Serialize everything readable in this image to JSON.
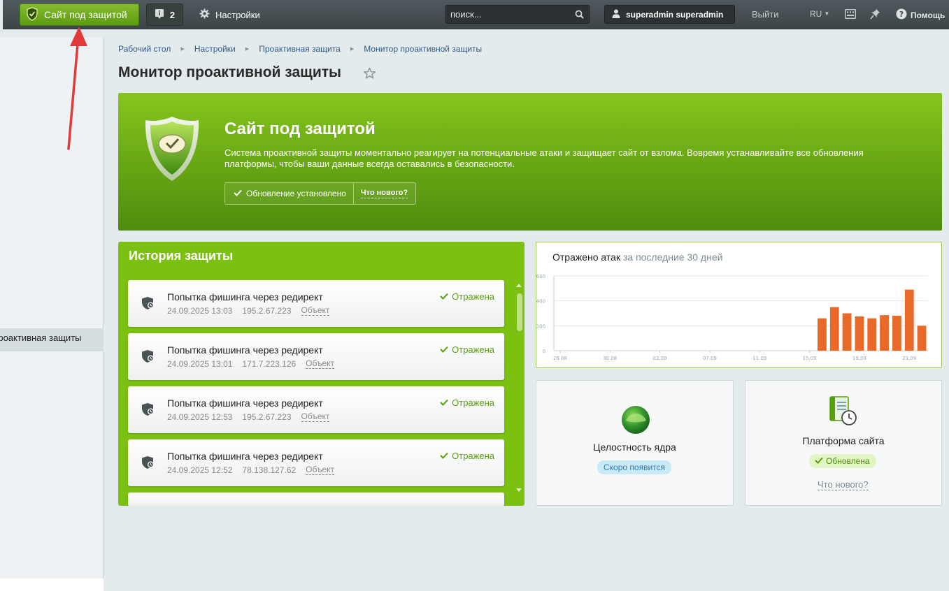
{
  "topbar": {
    "protect_label": "Сайт под защитой",
    "info_count": "2",
    "settings_label": "Настройки",
    "search_placeholder": "поиск...",
    "user_name": "superadmin superadmin",
    "logout_label": "Выйти",
    "lang_label": "RU",
    "help_label": "Помощь"
  },
  "sidebar": {
    "active_item_label": "Проактивная защиты"
  },
  "breadcrumb": [
    "Рабочий стол",
    "Настройки",
    "Проактивная защита",
    "Монитор проактивной защиты"
  ],
  "page": {
    "title": "Монитор проактивной защиты"
  },
  "banner": {
    "title": "Сайт под защитой",
    "text": "Система проактивной защиты моментально реагирует на потенциальные атаки и защищает сайт от взлома. Вовремя устанавливайте все обновления платформы, чтобы ваши данные всегда оставались в безопасности.",
    "update_status": "Обновление установлено",
    "whats_new": "Что нового?"
  },
  "history": {
    "title": "История защиты",
    "items": [
      {
        "title": "Попытка фишинга через редирект",
        "date": "24.09.2025 13:03",
        "ip": "195.2.67.223",
        "object": "Объект",
        "status": "Отражена"
      },
      {
        "title": "Попытка фишинга через редирект",
        "date": "24.09.2025 13:01",
        "ip": "171.7.223.126",
        "object": "Объект",
        "status": "Отражена"
      },
      {
        "title": "Попытка фишинга через редирект",
        "date": "24.09.2025 12:53",
        "ip": "195.2.67.223",
        "object": "Объект",
        "status": "Отражена"
      },
      {
        "title": "Попытка фишинга через редирект",
        "date": "24.09.2025 12:52",
        "ip": "78.138.127.62",
        "object": "Объект",
        "status": "Отражена"
      }
    ]
  },
  "chart_card": {
    "title_main": "Отражено атак",
    "title_muted": "за последние 30 дней"
  },
  "chart_data": {
    "type": "bar",
    "title": "Отражено атак за последние 30 дней",
    "xlabel": "",
    "ylabel": "",
    "ylim": [
      0,
      600
    ],
    "yticks": [
      "0",
      "200",
      "400",
      "600"
    ],
    "xticks": [
      "26.08",
      "30.08",
      "03.09",
      "07.09",
      "11.09",
      "15.09",
      "19.09",
      "23.09"
    ],
    "categories": [
      "26.08",
      "27.08",
      "28.08",
      "29.08",
      "30.08",
      "31.08",
      "01.09",
      "02.09",
      "03.09",
      "04.09",
      "05.09",
      "06.09",
      "07.09",
      "08.09",
      "09.09",
      "10.09",
      "11.09",
      "12.09",
      "13.09",
      "14.09",
      "15.09",
      "16.09",
      "17.09",
      "18.09",
      "19.09",
      "20.09",
      "21.09",
      "22.09",
      "23.09",
      "24.09"
    ],
    "values": [
      0,
      0,
      0,
      0,
      0,
      0,
      0,
      0,
      0,
      0,
      0,
      0,
      0,
      0,
      0,
      0,
      0,
      0,
      0,
      0,
      0,
      260,
      350,
      300,
      275,
      260,
      285,
      280,
      490,
      200
    ],
    "bar_color": "#e8692a",
    "grid": true
  },
  "kernel_card": {
    "title": "Целостность ядра",
    "badge": "Скоро появится"
  },
  "platform_card": {
    "title": "Платформа сайта",
    "badge": "Обновлена",
    "whats_new": "Что нового?"
  },
  "colors": {
    "accent_green": "#7cc012",
    "bar_orange": "#e8692a",
    "link_blue": "#2f5c8a"
  }
}
